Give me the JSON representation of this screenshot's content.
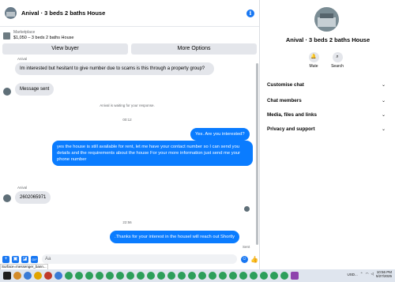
{
  "header": {
    "title": "Anival · 3 beds 2 baths House"
  },
  "listing": {
    "source": "Marketplace",
    "price_title": "$1,050 – 3 beds 2 baths House"
  },
  "actions": {
    "view_buyer": "View buyer",
    "more_options": "More Options"
  },
  "messages": [
    {
      "dir": "in",
      "sender": "Anival",
      "text": "Im interested but hesitant to give number due to scams is this through a property group?"
    },
    {
      "dir": "in",
      "text": "Message sent"
    },
    {
      "dir": "system",
      "text": "Anival is waiting for your response."
    },
    {
      "dir": "time",
      "text": "00:12"
    },
    {
      "dir": "out",
      "text": "Yes. Are you interested?"
    },
    {
      "dir": "out",
      "text": "yes the house is still available for rent, let me have your contact number so I can send you details and the requirements about the house For your more information just send me your phone number"
    },
    {
      "dir": "in",
      "sender": "Anival",
      "text": "2602065971"
    },
    {
      "dir": "time",
      "text": "22:56"
    },
    {
      "dir": "out",
      "text": ".Thanks for your interest in the housel will reach out Shortly"
    },
    {
      "dir": "status",
      "text": "Sent"
    }
  ],
  "composer": {
    "placeholder": "Aa"
  },
  "tooltip": "Surface=messenger_bann...",
  "right_panel": {
    "name": "Anival · 3 beds 2 baths House",
    "mute": "Mute",
    "search": "Search",
    "sections": [
      "Customise chat",
      "Chat members",
      "Media, files and links",
      "Privacy and support"
    ]
  },
  "taskbar": {
    "tray_label": "USD...",
    "time": "10:56 PM",
    "date": "5/27/2025"
  },
  "colors": {
    "accent": "#0a7cff",
    "incoming": "#e4e6eb"
  }
}
